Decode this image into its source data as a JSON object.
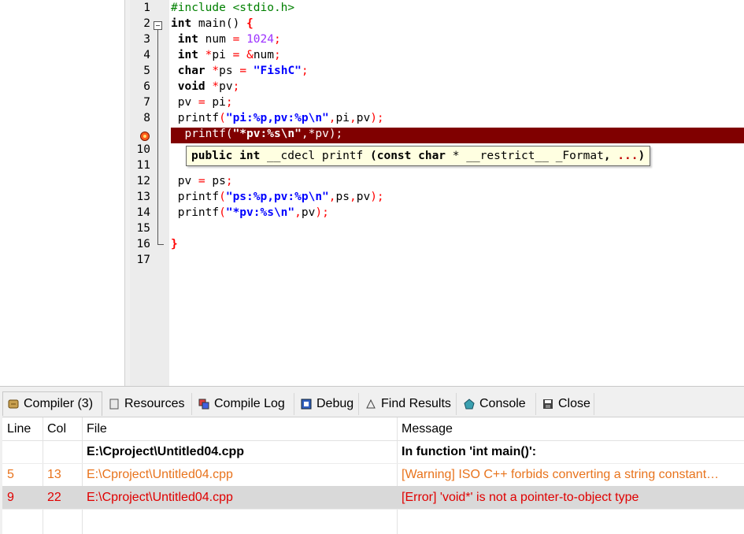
{
  "editor": {
    "lines": [
      {
        "n": "1",
        "tokens": [
          [
            "pre",
            "#include <stdio.h>"
          ]
        ]
      },
      {
        "n": "2",
        "tokens": [
          [
            "kw",
            "int"
          ],
          [
            "plain",
            " main() "
          ],
          [
            "sym",
            "{"
          ]
        ]
      },
      {
        "n": "3",
        "tokens": [
          [
            "plain",
            " "
          ],
          [
            "kw",
            "int"
          ],
          [
            "plain",
            " num "
          ],
          [
            "op",
            "="
          ],
          [
            "plain",
            " "
          ],
          [
            "num",
            "1024"
          ],
          [
            "op",
            ";"
          ]
        ]
      },
      {
        "n": "4",
        "tokens": [
          [
            "plain",
            " "
          ],
          [
            "kw",
            "int"
          ],
          [
            "plain",
            " "
          ],
          [
            "op",
            "*"
          ],
          [
            "plain",
            "pi "
          ],
          [
            "op",
            "="
          ],
          [
            "plain",
            " "
          ],
          [
            "op",
            "&"
          ],
          [
            "plain",
            "num"
          ],
          [
            "op",
            ";"
          ]
        ]
      },
      {
        "n": "5",
        "tokens": [
          [
            "plain",
            " "
          ],
          [
            "kw",
            "char"
          ],
          [
            "plain",
            " "
          ],
          [
            "op",
            "*"
          ],
          [
            "plain",
            "ps "
          ],
          [
            "op",
            "="
          ],
          [
            "plain",
            " "
          ],
          [
            "str",
            "\"FishC\""
          ],
          [
            "op",
            ";"
          ]
        ]
      },
      {
        "n": "6",
        "tokens": [
          [
            "plain",
            " "
          ],
          [
            "kw",
            "void"
          ],
          [
            "plain",
            " "
          ],
          [
            "op",
            "*"
          ],
          [
            "plain",
            "pv"
          ],
          [
            "op",
            ";"
          ]
        ]
      },
      {
        "n": "7",
        "tokens": [
          [
            "plain",
            " pv "
          ],
          [
            "op",
            "="
          ],
          [
            "plain",
            " pi"
          ],
          [
            "op",
            ";"
          ]
        ]
      },
      {
        "n": "8",
        "tokens": [
          [
            "plain",
            " printf"
          ],
          [
            "op",
            "("
          ],
          [
            "str",
            "\"pi:%p,pv:%p\\n\""
          ],
          [
            "op",
            ","
          ],
          [
            "plain",
            "pi"
          ],
          [
            "op",
            ","
          ],
          [
            "plain",
            "pv"
          ],
          [
            "op",
            ");"
          ]
        ]
      },
      {
        "n": "",
        "tokens": [
          [
            "plain",
            "  printf"
          ],
          [
            "op",
            "("
          ],
          [
            "str",
            "\"*pv:%s\\n\""
          ],
          [
            "op",
            ","
          ],
          [
            "op",
            "*"
          ],
          [
            "plain",
            "pv"
          ],
          [
            "op",
            ");"
          ]
        ]
      },
      {
        "n": "10",
        "tokens": []
      },
      {
        "n": "11",
        "tokens": []
      },
      {
        "n": "12",
        "tokens": [
          [
            "plain",
            " pv "
          ],
          [
            "op",
            "="
          ],
          [
            "plain",
            " ps"
          ],
          [
            "op",
            ";"
          ]
        ]
      },
      {
        "n": "13",
        "tokens": [
          [
            "plain",
            " printf"
          ],
          [
            "op",
            "("
          ],
          [
            "str",
            "\"ps:%p,pv:%p\\n\""
          ],
          [
            "op",
            ","
          ],
          [
            "plain",
            "ps"
          ],
          [
            "op",
            ","
          ],
          [
            "plain",
            "pv"
          ],
          [
            "op",
            ");"
          ]
        ]
      },
      {
        "n": "14",
        "tokens": [
          [
            "plain",
            " printf"
          ],
          [
            "op",
            "("
          ],
          [
            "str",
            "\"*pv:%s\\n\""
          ],
          [
            "op",
            ","
          ],
          [
            "plain",
            "pv"
          ],
          [
            "op",
            ");"
          ]
        ]
      },
      {
        "n": "15",
        "tokens": []
      },
      {
        "n": "16",
        "tokens": [
          [
            "sym",
            "}"
          ]
        ]
      },
      {
        "n": "17",
        "tokens": []
      }
    ],
    "tooltip": [
      [
        "b",
        "public int"
      ],
      [
        "n",
        " __cdecl printf "
      ],
      [
        "b",
        "(const char"
      ],
      [
        "n",
        " * __restrict__ _Format"
      ],
      [
        "b",
        ", "
      ],
      [
        "r",
        "..."
      ],
      [
        "b",
        ")"
      ]
    ]
  },
  "tabs": [
    {
      "label": "Compiler (3)",
      "icon": "compiler-icon",
      "active": true
    },
    {
      "label": "Resources",
      "icon": "resources-icon",
      "active": false
    },
    {
      "label": "Compile Log",
      "icon": "compile-log-icon",
      "active": false
    },
    {
      "label": "Debug",
      "icon": "debug-icon",
      "active": false
    },
    {
      "label": "Find Results",
      "icon": "find-results-icon",
      "active": false
    },
    {
      "label": "Console",
      "icon": "console-icon",
      "active": false
    },
    {
      "label": "Close",
      "icon": "close-icon",
      "active": false
    }
  ],
  "grid": {
    "headers": [
      "Line",
      "Col",
      "File",
      "Message"
    ],
    "rows": [
      {
        "line": "",
        "col": "",
        "file": "E:\\Cproject\\Untitled04.cpp",
        "message": "In function 'int main()':",
        "style": "bold"
      },
      {
        "line": "5",
        "col": "13",
        "file": "E:\\Cproject\\Untitled04.cpp",
        "message": "[Warning] ISO C++ forbids converting a string constant…",
        "style": "warning"
      },
      {
        "line": "9",
        "col": "22",
        "file": "E:\\Cproject\\Untitled04.cpp",
        "message": "[Error] 'void*' is not a pointer-to-object type",
        "style": "error"
      }
    ],
    "colors": {
      "warning": "#e8731c",
      "error": "#e00000",
      "selected_bg": "#d9d9d9"
    }
  }
}
